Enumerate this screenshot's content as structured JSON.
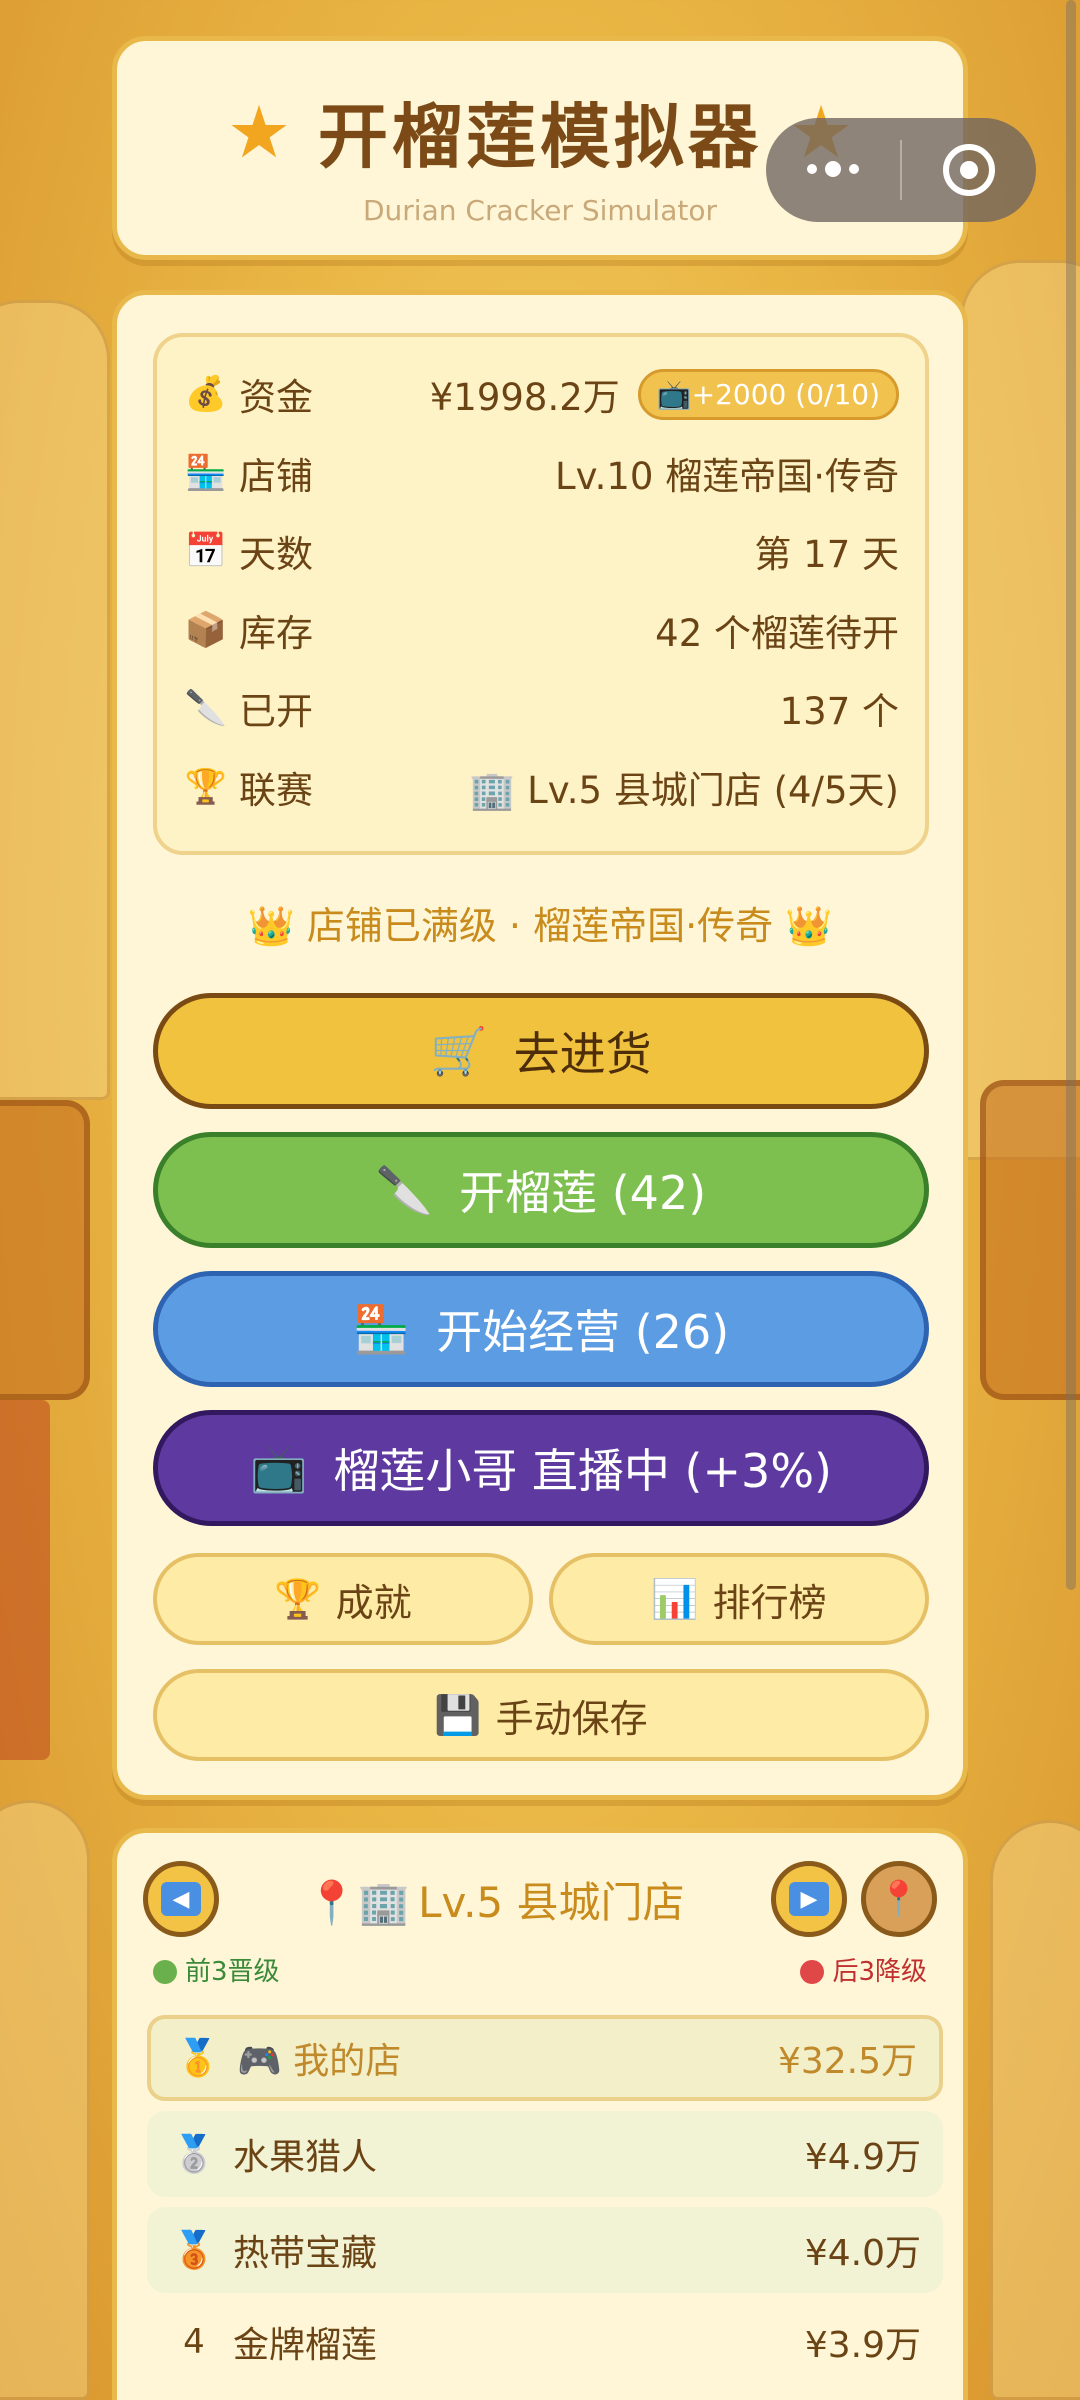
{
  "header": {
    "title": "开榴莲模拟器",
    "subtitle": "Durian Cracker Simulator",
    "star_icon": "★"
  },
  "capsule": {
    "more_icon": "more-dots-icon",
    "close_icon": "target-icon"
  },
  "stats": [
    {
      "icon": "💰",
      "icon_name": "money-bag-icon",
      "label": "资金",
      "value": "¥1998.2万"
    },
    {
      "icon": "🏪",
      "icon_name": "store-icon",
      "label": "店铺",
      "value": "Lv.10 榴莲帝国·传奇"
    },
    {
      "icon": "📅",
      "icon_name": "calendar-icon",
      "label": "天数",
      "value": "第 17 天"
    },
    {
      "icon": "📦",
      "icon_name": "box-icon",
      "label": "库存",
      "value": "42 个榴莲待开"
    },
    {
      "icon": "🔪",
      "icon_name": "knife-icon",
      "label": "已开",
      "value": "137 个"
    },
    {
      "icon": "🏆",
      "icon_name": "trophy-icon",
      "label": "联赛",
      "value": "🏢 Lv.5 县城门店 (4/5天)"
    }
  ],
  "ad_bonus": {
    "icon": "📺",
    "text": "+2000 (0/10)"
  },
  "max_level_line": "👑 店铺已满级 · 榴莲帝国·传奇 👑",
  "actions": {
    "restock": {
      "icon": "🛒",
      "label": "去进货"
    },
    "open": {
      "icon": "🔪",
      "label": "开榴莲 (42)"
    },
    "manage": {
      "icon": "🏪",
      "label": "开始经营 (26)"
    },
    "live": {
      "icon": "📺",
      "label": "榴莲小哥 直播中 (+3%)"
    },
    "achievements": {
      "icon": "🏆",
      "label": "成就"
    },
    "leaderboard": {
      "icon": "📊",
      "label": "排行榜"
    },
    "save": {
      "icon": "💾",
      "label": "手动保存"
    }
  },
  "league": {
    "title": "Lv.5 县城门店",
    "title_icons": "📍🏢",
    "prev_icon": "◀",
    "next_icon": "▶",
    "promote_note": "前3晋级",
    "demote_note": "后3降级",
    "rows": [
      {
        "rank": "🥇",
        "name": "🎮 我的店",
        "amount": "¥32.5万"
      },
      {
        "rank": "🥈",
        "name": "水果猎人",
        "amount": "¥4.9万"
      },
      {
        "rank": "🥉",
        "name": "热带宝藏",
        "amount": "¥4.0万"
      },
      {
        "rank": "4",
        "name": "金牌榴莲",
        "amount": "¥3.9万"
      }
    ]
  },
  "colors": {
    "accent": "#e8b84b",
    "text": "#6b4416",
    "gold": "#c88b1c"
  }
}
